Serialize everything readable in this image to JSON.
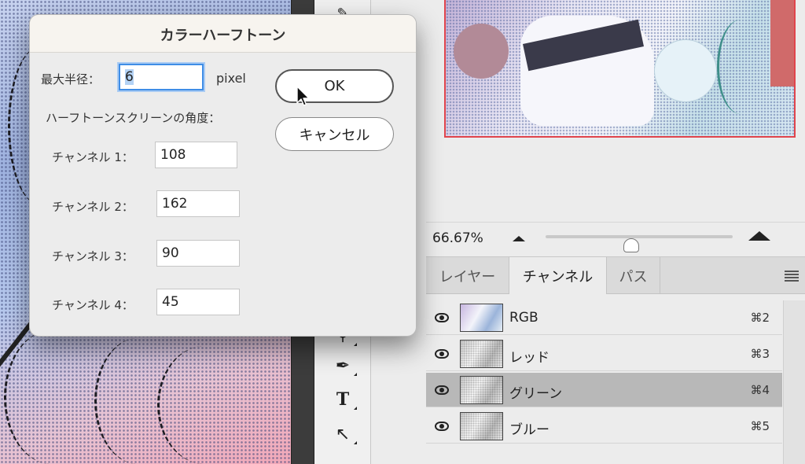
{
  "canvas": {
    "halftone_color": "#3c4678"
  },
  "toolbar": {
    "tools": [
      {
        "name": "brush-tool-icon",
        "glyph": "✎"
      },
      {
        "name": "pen-tool-icon",
        "glyph": "✒"
      },
      {
        "name": "text-tool-icon",
        "glyph": "T"
      },
      {
        "name": "path-selection-tool-icon",
        "glyph": "↖"
      }
    ]
  },
  "navigator": {
    "zoom": "66.67%",
    "zoom_level_fraction": 0.46
  },
  "panel": {
    "tabs": [
      "レイヤー",
      "チャンネル",
      "パス"
    ],
    "active_tab": "チャンネル",
    "channels": [
      {
        "name": "RGB",
        "shortcut": "⌘2",
        "visible": true,
        "selected": false
      },
      {
        "name": "レッド",
        "shortcut": "⌘3",
        "visible": true,
        "selected": false
      },
      {
        "name": "グリーン",
        "shortcut": "⌘4",
        "visible": true,
        "selected": true
      },
      {
        "name": "ブルー",
        "shortcut": "⌘5",
        "visible": true,
        "selected": false
      }
    ]
  },
  "dialog": {
    "title": "カラーハーフトーン",
    "max_radius_label": "最大半径：",
    "max_radius_value": "6",
    "max_radius_unit": "pixel",
    "angles_label": "ハーフトーンスクリーンの角度：",
    "channels": [
      {
        "label": "チャンネル 1：",
        "value": "108"
      },
      {
        "label": "チャンネル 2：",
        "value": "162"
      },
      {
        "label": "チャンネル 3：",
        "value": "90"
      },
      {
        "label": "チャンネル 4：",
        "value": "45"
      }
    ],
    "ok_label": "OK",
    "cancel_label": "キャンセル"
  },
  "colors": {
    "selection_border": "#e0444c",
    "focus_ring": "#3f8de6",
    "selected_row": "#b8b8b8"
  }
}
